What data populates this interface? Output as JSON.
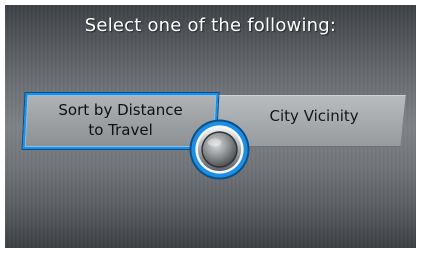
{
  "screen": {
    "title": "Select one of the following:"
  },
  "options": [
    {
      "label_line1": "Sort by Distance",
      "label_line2": "to Travel",
      "selected": true
    },
    {
      "label": "City Vicinity",
      "selected": false
    }
  ],
  "colors": {
    "highlight": "#1c8ee6",
    "text_light": "#ffffff",
    "text_dark": "#101010"
  },
  "icons": {
    "selector": "interface-dial-icon"
  }
}
